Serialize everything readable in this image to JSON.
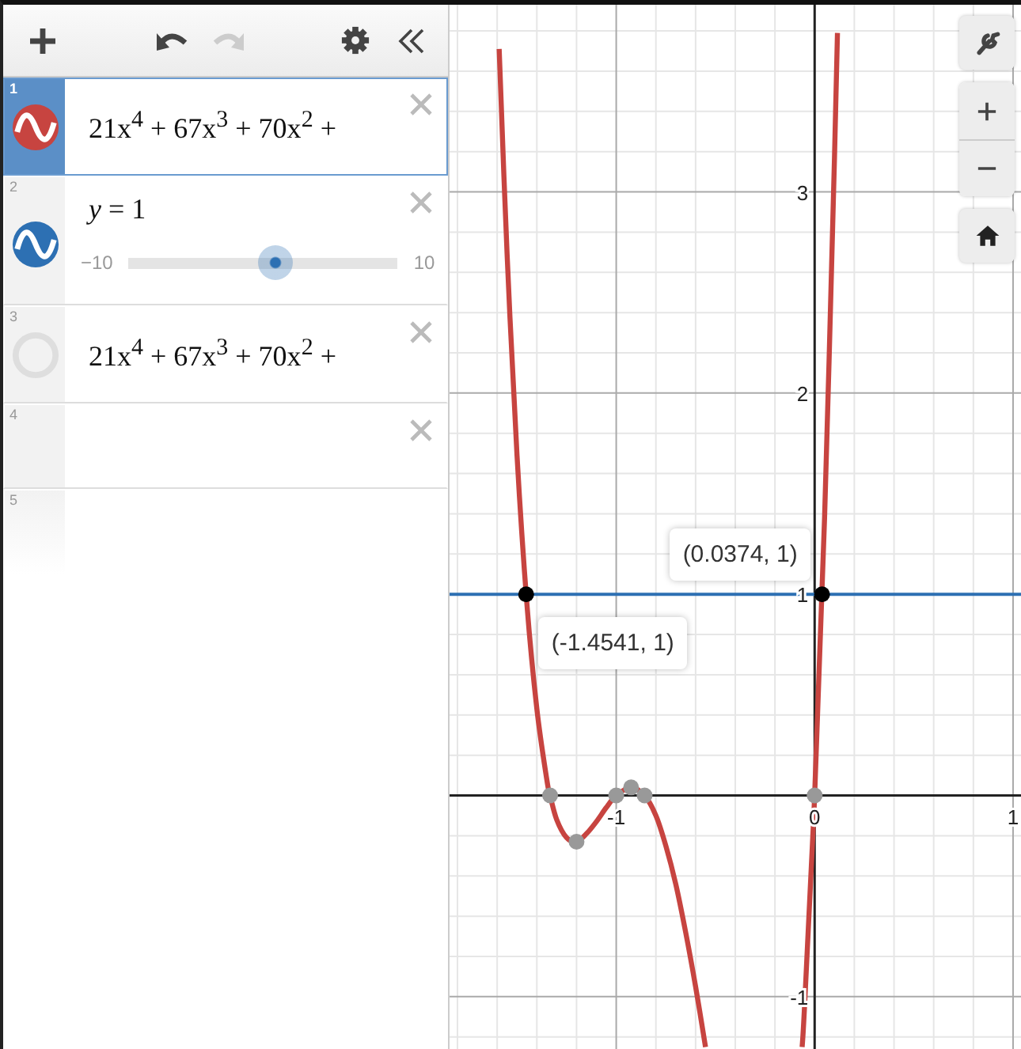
{
  "toolbar": {
    "undo_disabled": false,
    "redo_disabled": true
  },
  "expressions": [
    {
      "number": "1",
      "kind": "expression",
      "text": "21x$^{4}$ + 67x$^{3}$ + 70x$^{2}$ +",
      "color": "#c74440",
      "shown": true,
      "selected": true
    },
    {
      "number": "2",
      "kind": "slider",
      "text": "*y* = 1",
      "color": "#2d70b3",
      "shown": true,
      "selected": false,
      "slider": {
        "min": "−10",
        "max": "10",
        "level": 0.55
      }
    },
    {
      "number": "3",
      "kind": "expression",
      "text": "21x$^{4}$ + 67x$^{3}$ + 70x$^{2}$ +",
      "shown": false,
      "selected": false
    },
    {
      "number": "4",
      "kind": "empty",
      "selected": false
    },
    {
      "number": "5",
      "kind": "faded",
      "selected": false
    }
  ],
  "graph": {
    "chart_data": {
      "type": "line",
      "grid": true,
      "xlim": [
        -1.84,
        1.04
      ],
      "ylim": [
        -1.26,
        3.93
      ],
      "xticks": [
        {
          "value": -1,
          "label": "-1"
        },
        {
          "value": 0,
          "label": "0"
        },
        {
          "value": 1,
          "label": "1"
        }
      ],
      "yticks": [
        {
          "value": -1,
          "label": "-1"
        },
        {
          "value": 1,
          "label": "1"
        },
        {
          "value": 2,
          "label": "2"
        },
        {
          "value": 3,
          "label": "3"
        }
      ],
      "x": [
        -1.84,
        -1.59,
        -1.55,
        -1.5,
        -1.45,
        -1.4,
        -1.35,
        -1.3333,
        -1.3,
        -1.25,
        -1.2,
        -1.15,
        -1.1,
        -1.05,
        -1,
        -0.925,
        -0.857,
        -0.8,
        -0.75,
        -0.7,
        -0.65,
        -0.6,
        -0.55,
        -0.3,
        -0.063,
        -0.05,
        0,
        0.05,
        0.1,
        0.115,
        1.04
      ],
      "series": [
        {
          "color": "#c74440",
          "values": [
            null,
            3.71,
            2.69,
            1.69,
            0.95,
            0.43,
            0.08,
            0,
            -0.12,
            -0.21,
            -0.23,
            -0.19,
            -0.13,
            -0.06,
            0,
            0.04,
            0,
            -0.1,
            -0.25,
            -0.44,
            -0.68,
            -0.95,
            -1.25,
            null,
            -1.25,
            -1.03,
            0,
            1.38,
            3.17,
            3.79,
            null
          ]
        },
        {
          "color": "#2d70b3",
          "values": [
            1,
            1,
            1,
            1,
            1,
            1,
            1,
            1,
            1,
            1,
            1,
            1,
            1,
            1,
            1,
            1,
            1,
            1,
            1,
            1,
            1,
            1,
            1,
            1,
            1,
            1,
            1,
            1,
            1,
            1,
            1
          ]
        }
      ],
      "annotations": [
        {
          "x": -1.4541,
          "y": 1,
          "text": "(-1.4541, 1)"
        },
        {
          "x": 0.0374,
          "y": 1,
          "text": "(0.0374, 1)"
        }
      ]
    }
  }
}
